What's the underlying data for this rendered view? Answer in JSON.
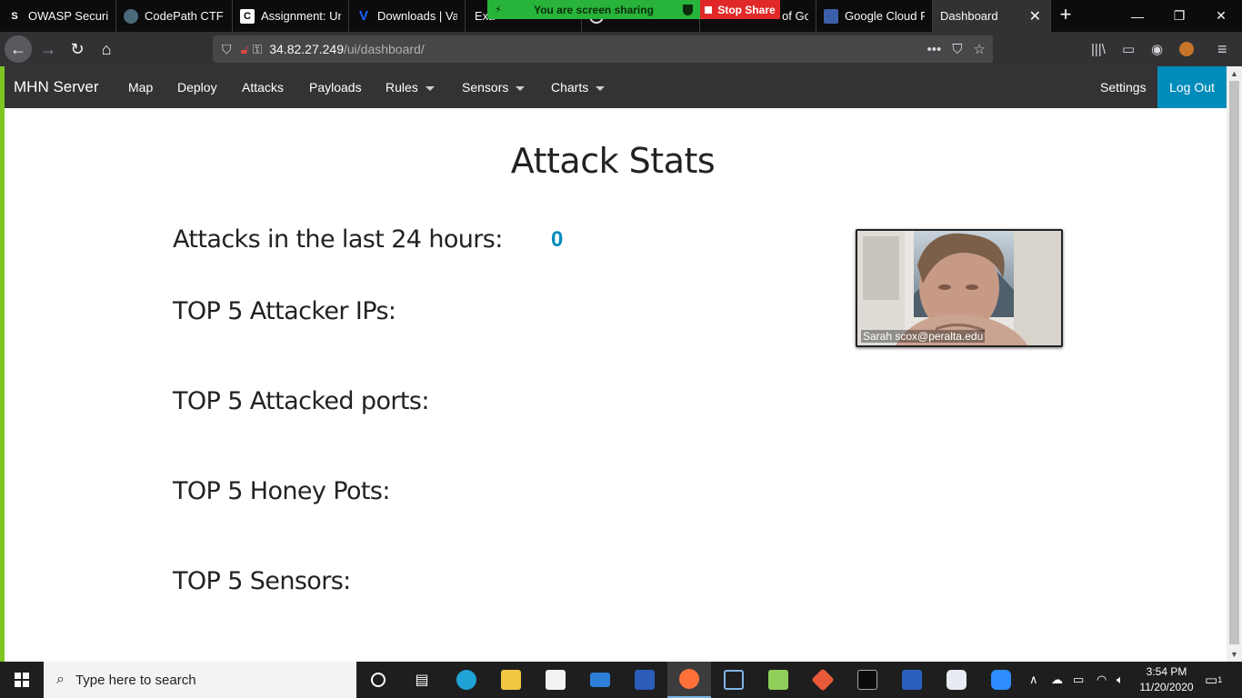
{
  "browser": {
    "tabs": [
      {
        "title": "OWASP Security",
        "fav": "S",
        "favcolor": "#ffffff",
        "favbg": "#0c0c0d"
      },
      {
        "title": "CodePath CTF",
        "fav": "",
        "favcolor": "#9ab",
        "favbg": "#4a6a7a"
      },
      {
        "title": "Assignment: Un",
        "fav": "C",
        "favcolor": "#000000",
        "favbg": "#ffffff"
      },
      {
        "title": "Downloads | Vag",
        "fav": "V",
        "favcolor": "#1563ff",
        "favbg": "#0c0c0d"
      },
      {
        "title": "Exa",
        "fav": "",
        "favcolor": "#fff",
        "favbg": "#0c0c0d"
      },
      {
        "title": "",
        "fav": "",
        "favcolor": "#fff",
        "favbg": "#0c0c0d"
      },
      {
        "title": "of Go",
        "fav": "",
        "favcolor": "#fff",
        "favbg": "#0c0c0d"
      },
      {
        "title": "Google Cloud Pl",
        "fav": "",
        "favcolor": "#8ab4f8",
        "favbg": "#3b5ea8"
      },
      {
        "title": "Dashboard",
        "fav": "",
        "favcolor": "#fff",
        "favbg": "#323234"
      }
    ],
    "new_tab": "+",
    "window_controls": {
      "minimize": "—",
      "maximize": "❐",
      "close": "✕"
    },
    "share_banner": "You are screen sharing",
    "stop_share": "Stop Share",
    "url": {
      "host": "34.82.27.249",
      "path": "/ui/dashboard/"
    },
    "url_actions": {
      "more": "•••",
      "pocket": "⛉",
      "star": "☆"
    },
    "toolbar": {
      "library": "|||\\",
      "sidebar": "▭",
      "account": "◉",
      "menu": "≡"
    }
  },
  "app": {
    "brand": "MHN Server",
    "nav": {
      "map": "Map",
      "deploy": "Deploy",
      "attacks": "Attacks",
      "payloads": "Payloads",
      "rules": "Rules",
      "sensors": "Sensors",
      "charts": "Charts",
      "settings": "Settings",
      "logout": "Log Out"
    },
    "page_title": "Attack Stats",
    "stats": {
      "attacks_24h_label": "Attacks in the last 24 hours:",
      "attacks_24h_value": "0",
      "top_ips_label": "TOP 5 Attacker IPs:",
      "top_ports_label": "TOP 5 Attacked ports:",
      "top_honeypots_label": "TOP 5 Honey Pots:",
      "top_sensors_label": "TOP 5 Sensors:"
    },
    "video_tile": {
      "name": "Sarah scox@peralta.edu"
    }
  },
  "taskbar": {
    "search_placeholder": "Type here to search",
    "time": "3:54 PM",
    "date": "11/20/2020",
    "notification_count": "1",
    "accent": "#78b4e6"
  }
}
